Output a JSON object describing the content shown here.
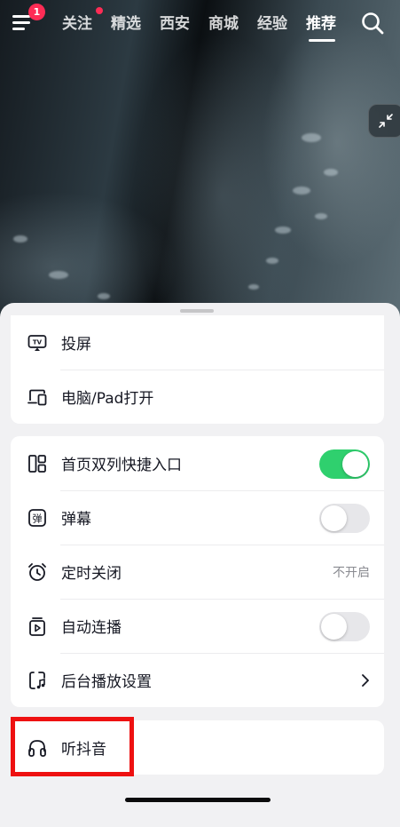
{
  "nav": {
    "menu_badge": "1",
    "tabs": [
      {
        "label": "关注",
        "has_dot": true
      },
      {
        "label": "精选"
      },
      {
        "label": "西安"
      },
      {
        "label": "商城"
      },
      {
        "label": "经验"
      },
      {
        "label": "推荐",
        "active": true
      }
    ]
  },
  "sheet": {
    "group1": [
      {
        "label": "投屏",
        "icon": "tv-cast-icon"
      },
      {
        "label": "电脑/Pad打开",
        "icon": "devices-icon"
      }
    ],
    "group2": [
      {
        "label": "首页双列快捷入口",
        "icon": "double-column-icon",
        "toggle": true
      },
      {
        "label": "弹幕",
        "icon": "danmaku-icon",
        "toggle": false
      },
      {
        "label": "定时关闭",
        "icon": "alarm-clock-icon",
        "value": "不开启"
      },
      {
        "label": "自动连播",
        "icon": "autoplay-icon",
        "toggle": false
      },
      {
        "label": "后台播放设置",
        "icon": "background-play-icon",
        "chevron": true
      }
    ],
    "group3": [
      {
        "label": "听抖音",
        "icon": "headphones-icon"
      }
    ]
  },
  "colors": {
    "accent_red": "#fe2c55",
    "toggle_on": "#2fd06e",
    "highlight_box": "#ee1111"
  }
}
